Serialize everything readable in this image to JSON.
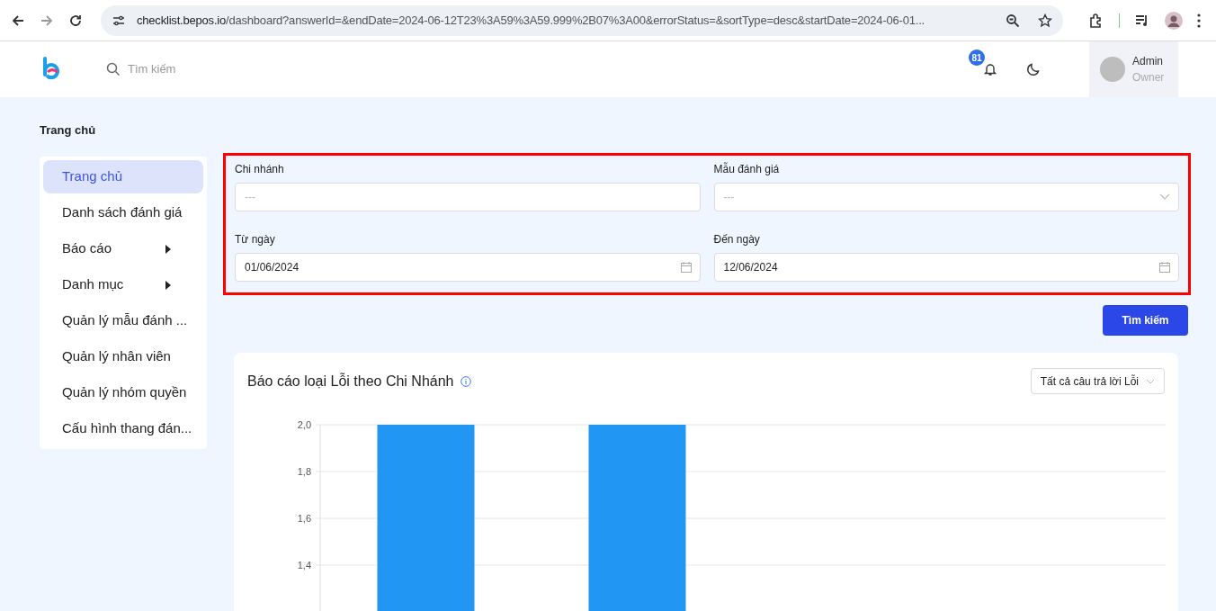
{
  "browser": {
    "url_host": "checklist.bepos.io",
    "url_path": "/dashboard?answerId=&endDate=2024-06-12T23%3A59%3A59.999%2B07%3A00&errorStatus=&sortType=desc&startDate=2024-06-01..."
  },
  "header": {
    "search": {
      "placeholder": "Tìm kiếm"
    },
    "notifications": {
      "count": "81"
    },
    "user": {
      "name": "Admin",
      "role": "Owner"
    }
  },
  "breadcrumb": "Trang chủ",
  "sidebar": {
    "items": [
      {
        "label": "Trang chủ",
        "selected": true,
        "submenu": false
      },
      {
        "label": "Danh sách đánh giá",
        "selected": false,
        "submenu": false
      },
      {
        "label": "Báo cáo",
        "selected": false,
        "submenu": true
      },
      {
        "label": "Danh mục",
        "selected": false,
        "submenu": true
      },
      {
        "label": "Quản lý mẫu đánh ...",
        "selected": false,
        "submenu": false
      },
      {
        "label": "Quản lý nhân viên",
        "selected": false,
        "submenu": false
      },
      {
        "label": "Quản lý nhóm quyền",
        "selected": false,
        "submenu": false
      },
      {
        "label": "Cấu hình thang đán...",
        "selected": false,
        "submenu": false
      }
    ]
  },
  "filters": [
    {
      "kind": "text",
      "label": "Chi nhánh",
      "placeholder": "---"
    },
    {
      "kind": "select",
      "label": "Mẫu đánh giá",
      "placeholder": "---"
    },
    {
      "kind": "date",
      "label": "Từ ngày",
      "value": "01/06/2024"
    },
    {
      "kind": "date",
      "label": "Đến ngày",
      "value": "12/06/2024"
    }
  ],
  "search_button": "Tìm kiếm",
  "report": {
    "title": "Báo cáo loại Lỗi theo Chi Nhánh",
    "filter": "Tất cả câu trả lời Lỗi",
    "chart_data": {
      "type": "bar",
      "grid": true,
      "values": [
        2,
        2,
        null,
        null
      ],
      "ylim": [
        1.2,
        2.0
      ],
      "yticks": [
        {
          "value": 1.4,
          "label": "1,4"
        },
        {
          "value": 1.6,
          "label": "1,6"
        },
        {
          "value": 1.8,
          "label": "1,8"
        },
        {
          "value": 2.0,
          "label": "2,0"
        }
      ]
    }
  }
}
